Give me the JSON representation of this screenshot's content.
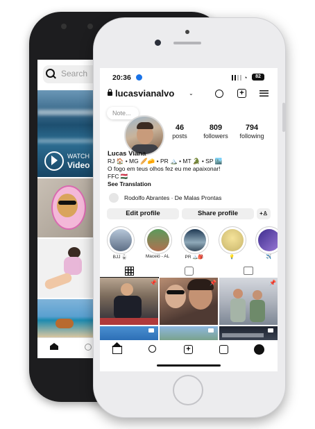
{
  "back_phone": {
    "search_placeholder": "Search",
    "watch_label": "WATCH",
    "video_label": "Video"
  },
  "status_bar": {
    "time": "20:36",
    "battery": "82"
  },
  "profile": {
    "username": "lucasvianalvo",
    "note": "Note...",
    "stats": [
      {
        "value": "46",
        "label": "posts"
      },
      {
        "value": "809",
        "label": "followers"
      },
      {
        "value": "794",
        "label": "following"
      }
    ],
    "name": "Lucas Viana",
    "bio_line1": "RJ 🏠 • MG 🥖🧀 • PR 🏔️ • MT 🐊 • SP 🏙️",
    "bio_line2": "O fogo em teus olhos fez eu me apaixonar!",
    "bio_line3": "FFC 🇭🇺",
    "see_translation": "See Translation",
    "mutual": "Rodolfo Abrantes · De Malas Prontas",
    "edit_profile": "Edit profile",
    "share_profile": "Share profile"
  },
  "highlights": [
    {
      "label": "BJJ 🥋",
      "color": "#7a8ca5"
    },
    {
      "label": "Maceió - AL",
      "color": "#4c8a4e"
    },
    {
      "label": "PR 🏔️🎒",
      "color": "#2f4d6b"
    },
    {
      "label": "💡",
      "color": "#d9c26a"
    },
    {
      "label": "✈️",
      "color": "#6b57b5"
    }
  ],
  "tabs": [
    "grid-icon",
    "reels-icon",
    "tagged-icon"
  ],
  "bottom_nav": [
    "home-icon",
    "search-icon",
    "create-icon",
    "reels-icon",
    "profile-icon"
  ]
}
